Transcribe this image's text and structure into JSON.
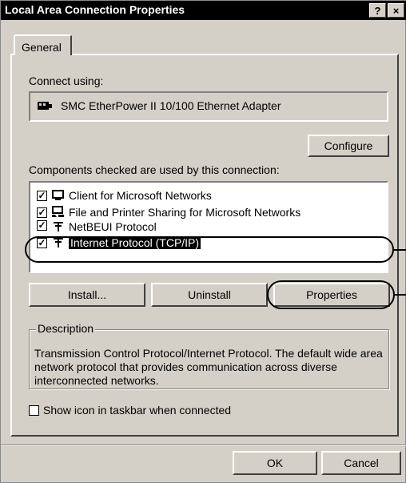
{
  "window": {
    "title": "Local Area Connection Properties"
  },
  "titlebar_buttons": {
    "help": "?",
    "close": "×"
  },
  "tabs": [
    {
      "label": "General"
    }
  ],
  "connect_using": {
    "label": "Connect using:",
    "adapter": "SMC EtherPower II 10/100 Ethernet Adapter",
    "configure_button": "Configure"
  },
  "components": {
    "label": "Components checked are used by this connection:",
    "items": [
      {
        "label": "Client for Microsoft Networks",
        "checked": true,
        "icon": "network-client-icon"
      },
      {
        "label": "File and Printer Sharing for Microsoft Networks",
        "checked": true,
        "icon": "sharing-icon"
      },
      {
        "label": "NetBEUI Protocol",
        "checked": true,
        "icon": "protocol-icon"
      },
      {
        "label": "Internet Protocol (TCP/IP)",
        "checked": true,
        "icon": "protocol-icon",
        "selected": true
      }
    ]
  },
  "buttons": {
    "install": "Install...",
    "uninstall": "Uninstall",
    "properties": "Properties",
    "ok": "OK",
    "cancel": "Cancel"
  },
  "description": {
    "legend": "Description",
    "text": "Transmission Control Protocol/Internet Protocol. The default wide area network protocol that provides communication across diverse interconnected networks."
  },
  "show_icon": {
    "label": "Show icon in taskbar when connected",
    "checked": false
  }
}
